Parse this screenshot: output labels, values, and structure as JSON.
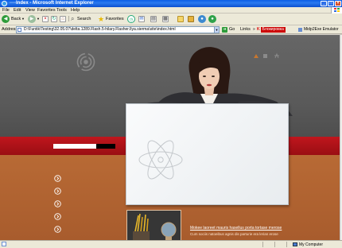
{
  "window": {
    "title": "Index - Microsoft Internet Explorer",
    "title_prefix": "----",
    "minimize_glyph": "_",
    "maximize_glyph": "□",
    "close_glyph": "×"
  },
  "menu": [
    "File",
    "Edit",
    "View",
    "Favorites",
    "Tools",
    "Help"
  ],
  "toolbar": {
    "back_label": "Back",
    "search_label": "Search",
    "favorites_label": "Favorites"
  },
  "address": {
    "label": "Address",
    "value": "D:\\Funtik\\Testing\\32.05.07\\delta.1289.Flash.5-hilary.Flasher.Ilya.sierma\\site\\index.html",
    "go_label": "Go",
    "links_label": "Links",
    "kaspersky_label": "K",
    "kaspersky_box": "Блокировка",
    "midp_label": "Midp2Exe Emulator"
  },
  "page": {
    "news_link": "Mokee laoreet mauris hasellus porta tortase merose",
    "news_text": "Cum sociis natoeibus agnis dis parturie era lerian erose"
  },
  "status": {
    "zone": "My Computer"
  },
  "colors": {
    "red_band": "#b01218",
    "copper": "#b06330",
    "dark_gray": "#5c5c5c"
  }
}
